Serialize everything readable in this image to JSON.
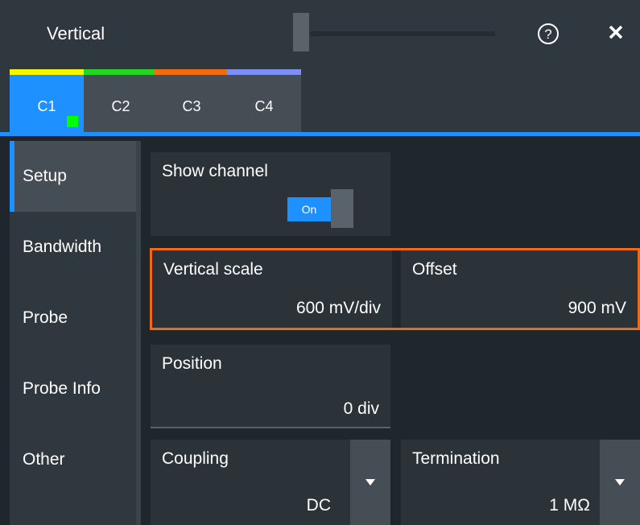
{
  "header": {
    "title": "Vertical",
    "help_icon": "help-circle-icon",
    "close_icon": "close-icon"
  },
  "tabs": [
    {
      "label": "C1",
      "color": "#f5f500",
      "active": true
    },
    {
      "label": "C2",
      "color": "#22d622"
    },
    {
      "label": "C3",
      "color": "#f06a10"
    },
    {
      "label": "C4",
      "color": "#7d8ff5"
    }
  ],
  "sidebar": {
    "items": [
      {
        "label": "Setup",
        "active": true
      },
      {
        "label": "Bandwidth"
      },
      {
        "label": "Probe"
      },
      {
        "label": "Probe Info"
      },
      {
        "label": "Other"
      }
    ]
  },
  "setup": {
    "show_channel": {
      "label": "Show channel",
      "state": "On"
    },
    "vertical_scale": {
      "label": "Vertical scale",
      "value": "600 mV/div"
    },
    "offset": {
      "label": "Offset",
      "value": "900 mV"
    },
    "position": {
      "label": "Position",
      "value": "0 div"
    },
    "coupling": {
      "label": "Coupling",
      "value": "DC"
    },
    "termination": {
      "label": "Termination",
      "value": "1 MΩ"
    }
  },
  "colors": {
    "accent": "#1e90ff",
    "highlight": "#f06a10",
    "active_indicator": "#00ff00"
  }
}
